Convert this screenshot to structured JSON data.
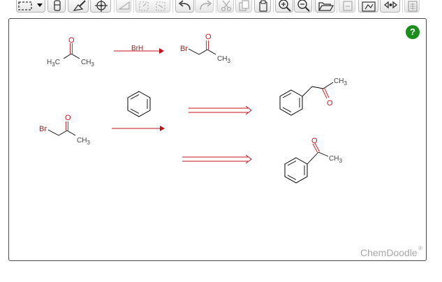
{
  "toolbar": {
    "buttons": [
      {
        "name": "select-tool",
        "icon": "marquee-select-icon"
      },
      {
        "name": "erase-tool",
        "icon": "eraser-icon"
      },
      {
        "name": "clean-tool",
        "icon": "broom-icon"
      },
      {
        "name": "center-tool",
        "icon": "crosshair-icon"
      },
      {
        "name": "flip-tool",
        "icon": "flip-icon"
      },
      {
        "name": "rotate-tool",
        "icon": "rotate-icon"
      },
      {
        "name": "undo-tool",
        "icon": "undo-icon"
      },
      {
        "name": "redo-tool",
        "icon": "redo-icon"
      },
      {
        "name": "cut-tool",
        "icon": "scissors-icon"
      },
      {
        "name": "copy-tool",
        "icon": "copy-icon"
      },
      {
        "name": "paste-tool",
        "icon": "paste-icon"
      },
      {
        "name": "zoom-in-tool",
        "icon": "zoom-in-icon"
      },
      {
        "name": "zoom-out-tool",
        "icon": "zoom-out-icon"
      },
      {
        "name": "open-tool",
        "icon": "folder-icon"
      },
      {
        "name": "save-tool",
        "icon": "save-icon"
      },
      {
        "name": "template-tool",
        "icon": "template-icon"
      },
      {
        "name": "settings-tool",
        "icon": "settings-icon"
      },
      {
        "name": "calculator-tool",
        "icon": "calculator-icon"
      }
    ]
  },
  "help_label": "?",
  "brand": {
    "name": "ChemDoodle",
    "mark": "®"
  },
  "molecules": {
    "acetone": {
      "O": "O",
      "left": "H3C",
      "right": "CH3"
    },
    "reagent": "BrH",
    "bromoacetone_top": {
      "Br": "Br",
      "O": "O",
      "CH3": "CH3"
    },
    "bromoacetone_left": {
      "Br": "Br",
      "O": "O",
      "CH3": "CH3"
    },
    "phenylacetone": {
      "O": "O",
      "CH3": "CH3"
    },
    "acetophenone": {
      "O": "O",
      "CH3": "CH3"
    }
  },
  "colors": {
    "oxygen": "#e0101a",
    "bromine": "#a02020",
    "arrow": "#c0101a",
    "bond": "#000000",
    "retro": "#c0101a"
  }
}
